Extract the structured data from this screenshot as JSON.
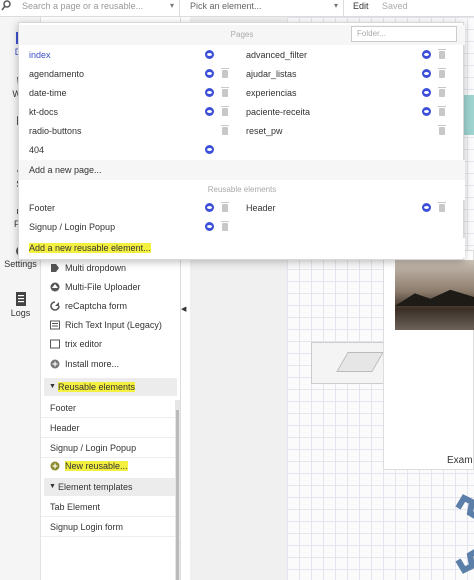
{
  "topbar": {
    "search_placeholder": "Search a page or a reusable...",
    "pick_element": "Pick an element...",
    "edit": "Edit",
    "saved": "Saved"
  },
  "rail": {
    "items": [
      {
        "label": "De",
        "icon": "design-icon"
      },
      {
        "label": "Wor",
        "icon": "workflow-icon"
      },
      {
        "label": "D",
        "icon": "data-icon"
      },
      {
        "label": "St",
        "icon": "styles-icon"
      },
      {
        "label": "Plu",
        "icon": "plugins-icon"
      },
      {
        "label": "Settings",
        "icon": "settings-icon"
      },
      {
        "label": "Logs",
        "icon": "logs-icon"
      }
    ]
  },
  "panel": {
    "elements": [
      {
        "label": "Multi dropdown",
        "icon": "tag-icon"
      },
      {
        "label": "Multi-File Uploader",
        "icon": "upload-icon"
      },
      {
        "label": "reCaptcha form",
        "icon": "recaptcha-icon"
      },
      {
        "label": "Rich Text Input (Legacy)",
        "icon": "richtext-icon"
      },
      {
        "label": "trix editor",
        "icon": "editor-icon"
      },
      {
        "label": "Install more...",
        "icon": "plus-icon"
      }
    ],
    "reusable_header": "Reusable elements",
    "reusable": [
      "Footer",
      "Header",
      "Signup / Login Popup"
    ],
    "new_reusable": "New reusable...",
    "templates_header": "Element templates",
    "templates": [
      "Tab Element",
      "Signup Login form"
    ]
  },
  "popup": {
    "pages_header": "Pages",
    "filter_placeholder": "Folder...",
    "pages_left": [
      "index",
      "agendamento",
      "date-time",
      "kt-docs",
      "radio-buttons",
      "404"
    ],
    "pages_right": [
      "advanced_filter",
      "ajudar_listas",
      "experiencias",
      "paciente-receita",
      "reset_pw"
    ],
    "add_page": "Add a new page...",
    "reusable_header": "Reusable elements",
    "reusable_left": [
      "Footer",
      "Signup / Login Popup"
    ],
    "reusable_right": [
      "Header"
    ],
    "add_reusable": "Add a new reusable element..."
  },
  "canvas": {
    "card_text": "Exam"
  },
  "colors": {
    "accent": "#3b4fcf",
    "highlight": "#f4f040"
  }
}
